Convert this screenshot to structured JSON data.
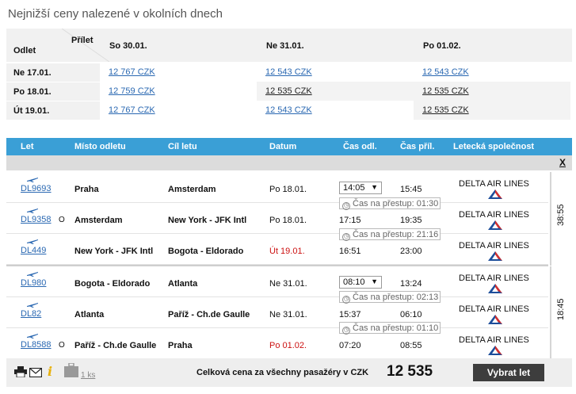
{
  "title": "Nejnižší ceny nalezené v okolních dnech",
  "matrix": {
    "prilet_label": "Přílet",
    "odlet_label": "Odlet",
    "columns": [
      "So 30.01.",
      "Ne 31.01.",
      "Po 01.02."
    ],
    "rows": [
      {
        "label": "Ne 17.01.",
        "cells": [
          "12 767 CZK",
          "12 543 CZK",
          "12 543 CZK"
        ]
      },
      {
        "label": "Po 18.01.",
        "cells": [
          "12 759 CZK",
          "12 535 CZK",
          "12 535 CZK"
        ]
      },
      {
        "label": "Út 19.01.",
        "cells": [
          "12 767 CZK",
          "12 543 CZK",
          "12 535 CZK"
        ]
      }
    ]
  },
  "flights": {
    "headers": [
      "Let",
      "Místo odletu",
      "Cíl letu",
      "Datum",
      "Čas odl.",
      "Čas příl.",
      "Letecká společnost"
    ],
    "close_label": "X",
    "transfer_prefix": "Čas na přestup:",
    "segments": [
      {
        "code": "DL9693",
        "circle": "",
        "from": "Praha",
        "to": "Amsterdam",
        "date": "Po 18.01.",
        "dep": "14:05",
        "arr": "15:45",
        "airline": "DELTA AIR LINES",
        "transfer": "01:30"
      },
      {
        "code": "DL9358",
        "circle": "O",
        "from": "Amsterdam",
        "to": "New York - JFK Intl",
        "date": "Po 18.01.",
        "dep": "17:15",
        "arr": "19:35",
        "airline": "DELTA AIR LINES",
        "transfer": "21:16"
      },
      {
        "code": "DL449",
        "circle": "",
        "from": "New York - JFK Intl",
        "to": "Bogota - Eldorado",
        "date": "Út 19.01.",
        "dep": "16:51",
        "arr": "23:00",
        "airline": "DELTA AIR LINES",
        "transfer": ""
      },
      {
        "code": "DL980",
        "circle": "",
        "from": "Bogota - Eldorado",
        "to": "Atlanta",
        "date": "Ne 31.01.",
        "dep": "08:10",
        "arr": "13:24",
        "airline": "DELTA AIR LINES",
        "transfer": "02:13"
      },
      {
        "code": "DL82",
        "circle": "",
        "from": "Atlanta",
        "to": "Paříž - Ch.de Gaulle",
        "date": "Ne 31.01.",
        "dep": "15:37",
        "arr": "06:10",
        "airline": "DELTA AIR LINES",
        "transfer": "01:10"
      },
      {
        "code": "DL8588",
        "circle": "O",
        "from": "Paříž - Ch.de Gaulle",
        "to": "Praha",
        "date": "Po 01.02.",
        "dep": "07:20",
        "arr": "08:55",
        "airline": "DELTA AIR LINES",
        "transfer": ""
      }
    ],
    "durations": [
      "38:55",
      "18:45"
    ]
  },
  "footer": {
    "bag_count": "1 ks",
    "total_label": "Celková cena za všechny pasažéry v CZK",
    "total_value": "12 535",
    "select_label": "Vybrat let"
  },
  "colors": {
    "header_blue": "#3a9fd6",
    "link": "#2a68b2",
    "red_date": "#cc1111",
    "delta_red": "#d32f2f",
    "delta_blue": "#1c4d9a"
  }
}
